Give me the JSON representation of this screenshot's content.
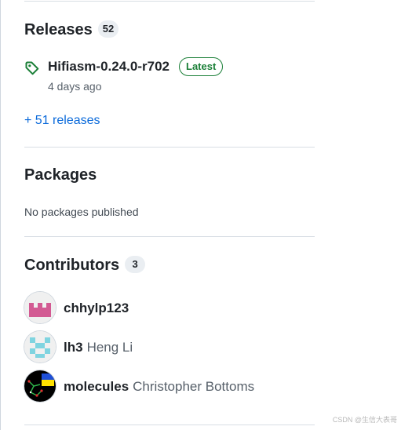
{
  "releases": {
    "title": "Releases",
    "count": "52",
    "latest": {
      "name": "Hifiasm-0.24.0-r702",
      "badge": "Latest",
      "date": "4 days ago",
      "icon": "tag-icon"
    },
    "more_link": "+ 51 releases"
  },
  "packages": {
    "title": "Packages",
    "empty_text": "No packages published"
  },
  "contributors": {
    "title": "Contributors",
    "count": "3",
    "items": [
      {
        "login": "chhylp123",
        "name": ""
      },
      {
        "login": "lh3",
        "name": "Heng Li"
      },
      {
        "login": "molecules",
        "name": "Christopher Bottoms"
      }
    ]
  },
  "watermark": "CSDN @生信大表哥",
  "colors": {
    "link": "#0969da",
    "latest_green": "#1a7f37",
    "muted_text": "#57606a",
    "divider": "#d8dee4"
  }
}
